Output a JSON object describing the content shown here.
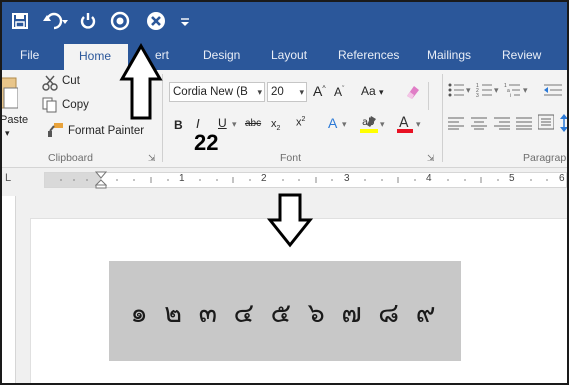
{
  "tabs": [
    {
      "label": "File"
    },
    {
      "label": "Home"
    },
    {
      "label": "Insert"
    },
    {
      "label": "Design"
    },
    {
      "label": "Layout"
    },
    {
      "label": "References"
    },
    {
      "label": "Mailings"
    },
    {
      "label": "Review"
    }
  ],
  "tab_home_visible": "Home",
  "tab_insert_visible": "ert",
  "clipboard": {
    "cut_label": "Cut",
    "copy_label": "Copy",
    "paste_label": "Paste",
    "format_painter_label": "Format Painter",
    "group_label": "Clipboard"
  },
  "font": {
    "font_name": "Cordia New (B",
    "font_size": "20",
    "case_label": "Aa",
    "group_label": "Font",
    "strike_label": "abc"
  },
  "paragraph": {
    "group_label": "Paragrapl"
  },
  "ruler": {
    "numbers": [
      "1",
      "2",
      "3",
      "4",
      "5",
      "6"
    ]
  },
  "annotation": {
    "size_text": "22"
  },
  "document": {
    "numerals": "๑ ๒ ๓ ๔ ๕ ๖ ๗ ๘ ๙"
  },
  "colors": {
    "title_bar": "#2b579a",
    "ribbon": "#f3f3f3",
    "highlight": "#ffff00",
    "font_color": "#e81123",
    "numerals_box": "#c8c8c8"
  }
}
